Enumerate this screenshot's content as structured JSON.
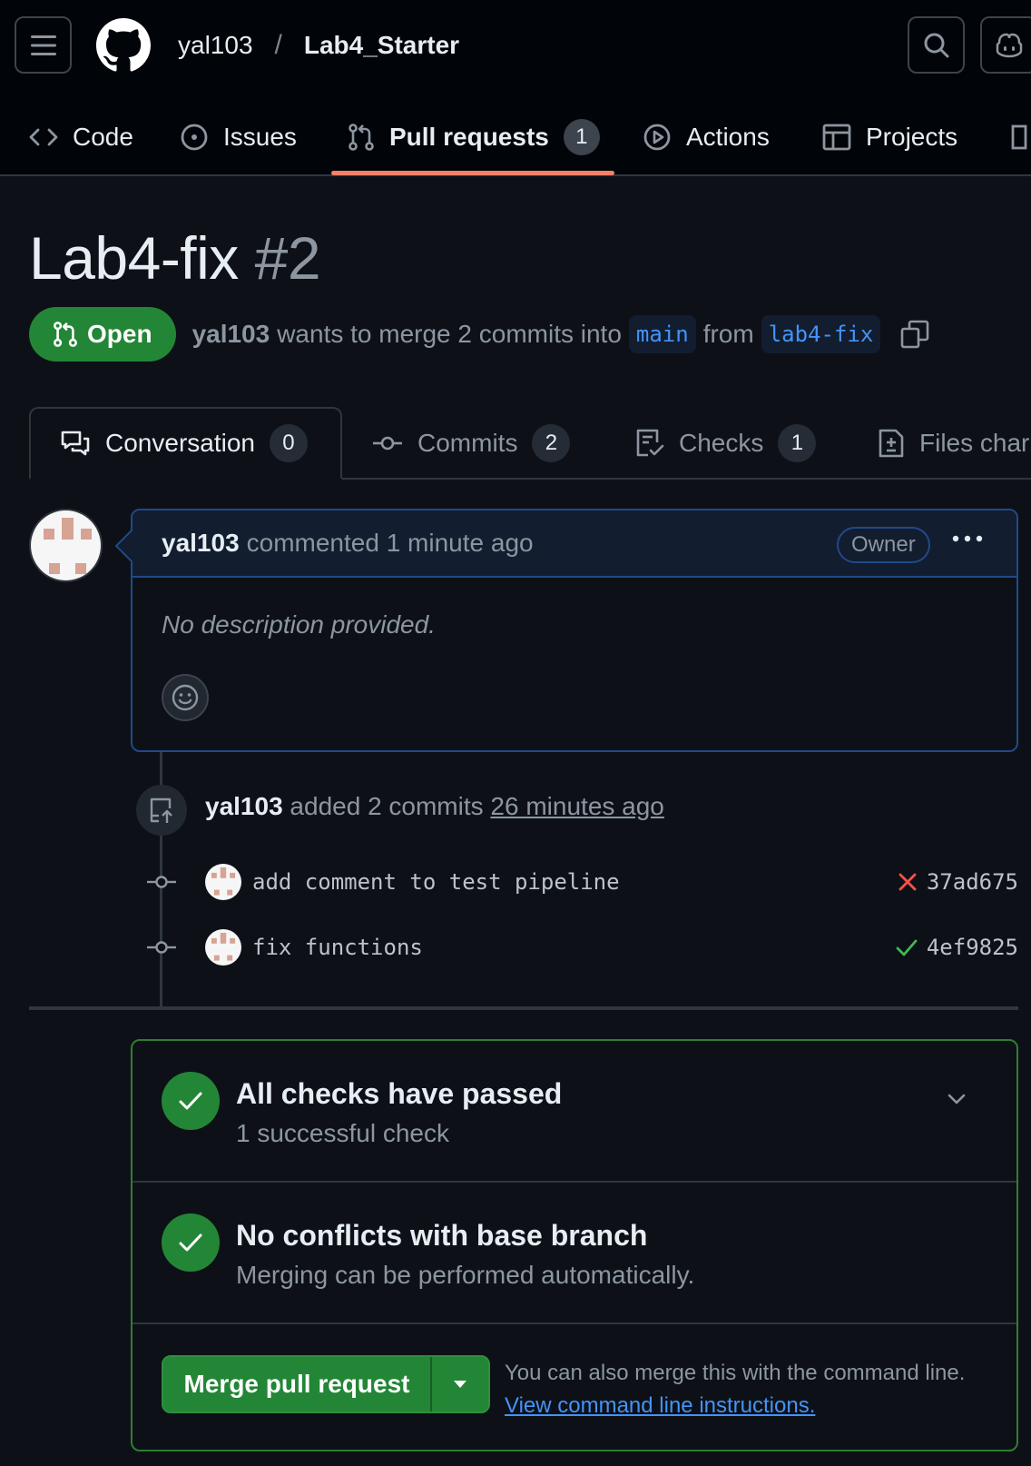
{
  "header": {
    "owner": "yal103",
    "separator": "/",
    "repo": "Lab4_Starter"
  },
  "nav": {
    "code": "Code",
    "issues": "Issues",
    "pull_requests": "Pull requests",
    "pull_requests_count": "1",
    "actions": "Actions",
    "projects": "Projects"
  },
  "pr": {
    "title": "Lab4-fix",
    "number": "#2",
    "state": "Open",
    "author": "yal103",
    "merge_text": "wants to merge 2 commits into",
    "base_branch": "main",
    "from_text": "from",
    "head_branch": "lab4-fix"
  },
  "tabs": {
    "conversation": "Conversation",
    "conversation_count": "0",
    "commits": "Commits",
    "commits_count": "2",
    "checks": "Checks",
    "checks_count": "1",
    "files": "Files char"
  },
  "comment": {
    "author": "yal103",
    "meta": "commented 1 minute ago",
    "role": "Owner",
    "body": "No description provided."
  },
  "event": {
    "author": "yal103",
    "text": "added 2 commits",
    "time": "26 minutes ago"
  },
  "commits": [
    {
      "message": "add comment to test pipeline",
      "status": "failed",
      "sha": "37ad675"
    },
    {
      "message": "fix functions",
      "status": "passed",
      "sha": "4ef9825"
    }
  ],
  "merge": {
    "checks_title": "All checks have passed",
    "checks_sub": "1 successful check",
    "conflicts_title": "No conflicts with base branch",
    "conflicts_sub": "Merging can be performed automatically.",
    "button": "Merge pull request",
    "hint": "You can also merge this with the command line.",
    "hint_link": "View command line instructions."
  },
  "colors": {
    "background": "#0d1117",
    "accent_green": "#238636",
    "link_blue": "#4493f8",
    "tab_underline": "#f78166",
    "fail_red": "#f85149"
  }
}
